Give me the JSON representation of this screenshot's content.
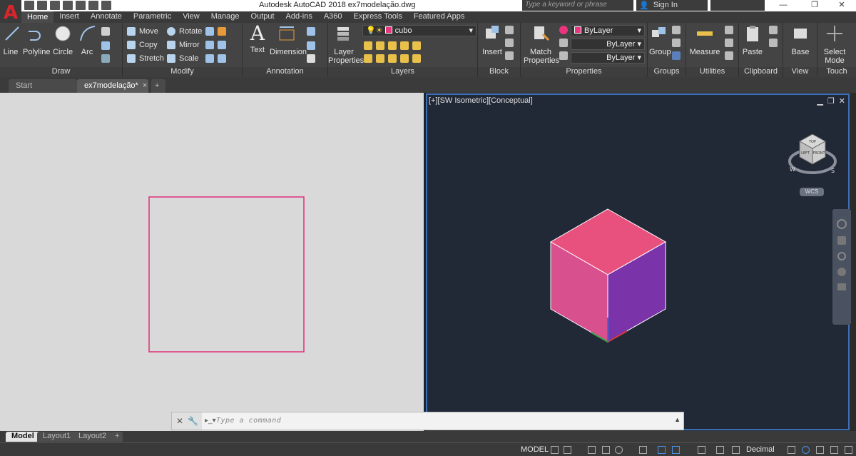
{
  "app": {
    "title": "Autodesk AutoCAD 2018    ex7modelação.dwg",
    "search_placeholder": "Type a keyword or phrase",
    "sign_in": "Sign In",
    "logo_letter": "A"
  },
  "ribbon_tabs": [
    "Home",
    "Insert",
    "Annotate",
    "Parametric",
    "View",
    "Manage",
    "Output",
    "Add-ins",
    "A360",
    "Express Tools",
    "Featured Apps"
  ],
  "panels": {
    "draw": {
      "title": "Draw",
      "line": "Line",
      "polyline": "Polyline",
      "circle": "Circle",
      "arc": "Arc"
    },
    "modify": {
      "title": "Modify",
      "move": "Move",
      "rotate": "Rotate",
      "copy": "Copy",
      "mirror": "Mirror",
      "stretch": "Stretch",
      "scale": "Scale"
    },
    "annotation": {
      "title": "Annotation",
      "text": "Text",
      "dimension": "Dimension"
    },
    "layers": {
      "title": "Layers",
      "layer_props_1": "Layer",
      "layer_props_2": "Properties",
      "current_layer": "cubo"
    },
    "block": {
      "title": "Block",
      "insert": "Insert"
    },
    "properties": {
      "title": "Properties",
      "match_1": "Match",
      "match_2": "Properties",
      "color": "ByLayer",
      "linetype": "ByLayer",
      "lineweight": "ByLayer"
    },
    "groups": {
      "title": "Groups",
      "group": "Group"
    },
    "utilities": {
      "title": "Utilities",
      "measure": "Measure"
    },
    "clipboard": {
      "title": "Clipboard",
      "paste": "Paste"
    },
    "view": {
      "title": "View",
      "base": "Base"
    },
    "touch": {
      "title": "Touch",
      "select_1": "Select",
      "select_2": "Mode"
    }
  },
  "doc_tabs": {
    "start": "Start",
    "active": "ex7modelação*",
    "new": "+"
  },
  "viewport": {
    "label": "[+][SW Isometric][Conceptual]",
    "wcs": "WCS"
  },
  "viewcube": {
    "top": "TOP",
    "left": "LEFT",
    "front": "FRONT",
    "w": "W",
    "s": "S"
  },
  "command_line": {
    "placeholder": "Type a command"
  },
  "layout_tabs": [
    "Model",
    "Layout1",
    "Layout2"
  ],
  "status": {
    "model": "MODEL",
    "units": "Decimal"
  },
  "colors": {
    "cube_top": "#e8517e",
    "cube_left": "#d9508f",
    "cube_right": "#7a33a8",
    "square": "#e0307a",
    "accent": "#3d6fb8"
  }
}
